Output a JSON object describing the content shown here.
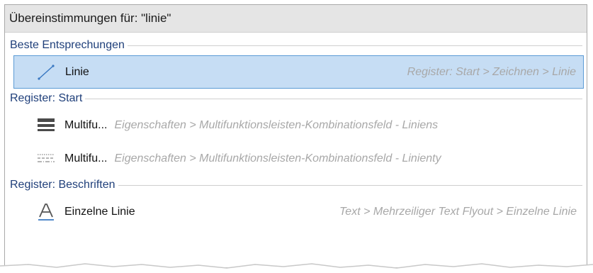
{
  "header": {
    "title": "Übereinstimmungen für: \"linie\""
  },
  "sections": [
    {
      "label": "Beste Entsprechungen",
      "items": [
        {
          "icon": "line-icon",
          "title": "Linie",
          "path": "Register: Start > Zeichnen > Linie",
          "selected": true
        }
      ]
    },
    {
      "label": "Register: Start",
      "items": [
        {
          "icon": "line-weight-icon",
          "title": "Multifu...",
          "path": "Eigenschaften > Multifunktionsleisten-Kombinationsfeld - Liniens"
        },
        {
          "icon": "line-type-icon",
          "title": "Multifu...",
          "path": "Eigenschaften > Multifunktionsleisten-Kombinationsfeld - Linienty"
        }
      ]
    },
    {
      "label": "Register: Beschriften",
      "items": [
        {
          "icon": "text-icon",
          "title": "Einzelne Linie",
          "path": "Text > Mehrzeiliger Text Flyout > Einzelne Linie"
        }
      ]
    }
  ],
  "colors": {
    "accent": "#5b9bd5",
    "selection": "#c6ddf4",
    "section_text": "#1f3f7a"
  }
}
